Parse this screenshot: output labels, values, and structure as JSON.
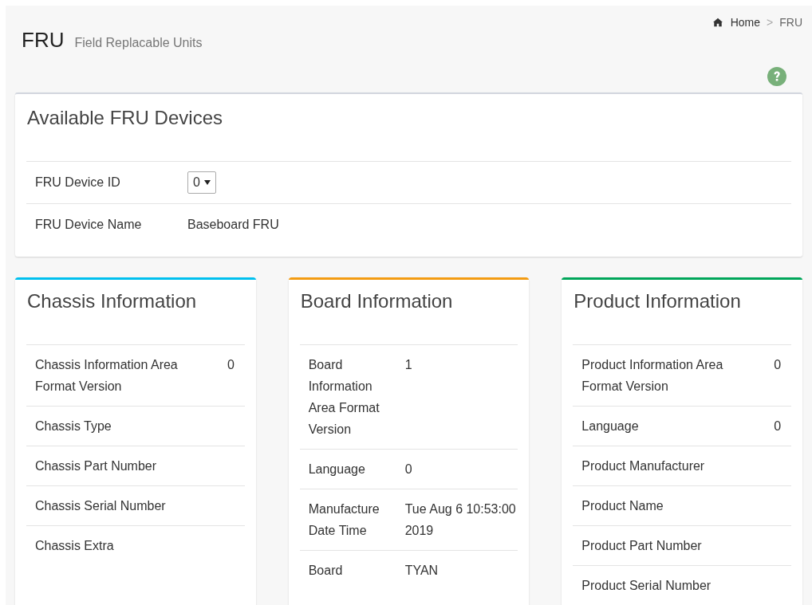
{
  "page": {
    "title": "FRU",
    "subtitle": "Field Replacable Units"
  },
  "breadcrumb": [
    {
      "label": "Home",
      "kind": "home"
    },
    {
      "label": ">",
      "kind": "separator"
    },
    {
      "label": "FRU",
      "kind": "current"
    }
  ],
  "devices": {
    "title": "Available FRU Devices",
    "device_id": {
      "label": "FRU Device ID",
      "value": "0"
    },
    "device_name": {
      "label": "FRU Device Name",
      "value": "Baseboard FRU"
    }
  },
  "sections": [
    {
      "title": "Chassis Information",
      "color": "#00c0ef",
      "rows": [
        {
          "label": "Chassis Information Area Format Version",
          "value": "0"
        },
        {
          "label": "Chassis Type",
          "value": ""
        },
        {
          "label": "Chassis Part Number",
          "value": ""
        },
        {
          "label": "Chassis Serial Number",
          "value": ""
        },
        {
          "label": "Chassis Extra",
          "value": ""
        }
      ]
    },
    {
      "title": "Board Information",
      "color": "#f39c12",
      "rows": [
        {
          "label": "Board Information Area Format Version",
          "value": "1"
        },
        {
          "label": "Language",
          "value": "0"
        },
        {
          "label": "Manufacture Date Time",
          "value": "Tue Aug 6 10:53:00 2019"
        },
        {
          "label": "Board",
          "value": "TYAN"
        }
      ]
    },
    {
      "title": "Product Information",
      "color": "#00a65a",
      "rows": [
        {
          "label": "Product Information Area Format Version",
          "value": "0"
        },
        {
          "label": "Language",
          "value": "0"
        },
        {
          "label": "Product Manufacturer",
          "value": ""
        },
        {
          "label": "Product Name",
          "value": ""
        },
        {
          "label": "Product Part Number",
          "value": ""
        },
        {
          "label": "Product Serial Number",
          "value": ""
        }
      ]
    }
  ]
}
